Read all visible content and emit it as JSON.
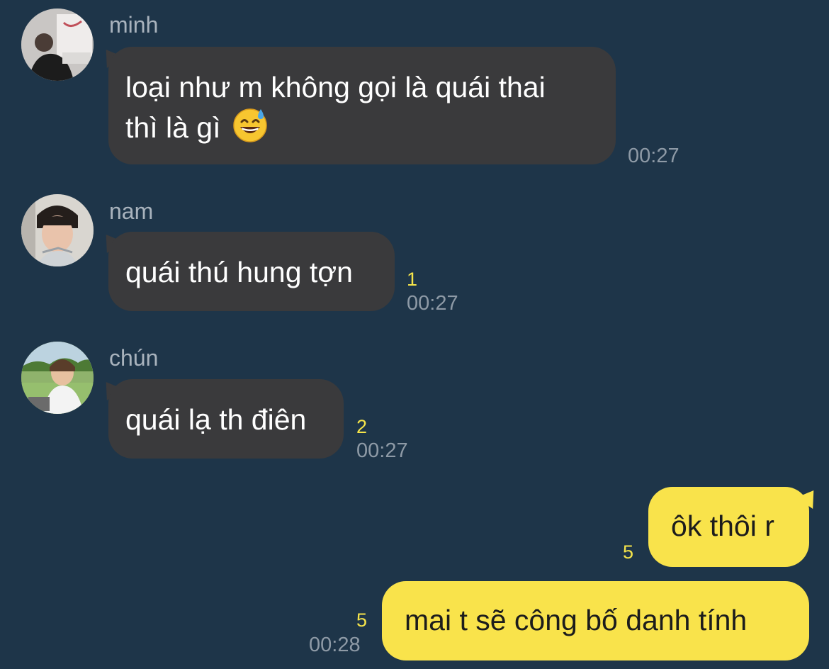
{
  "messages": [
    {
      "sender": "minh",
      "text_line1": "loại như m không gọi là quái thai",
      "text_line2": "thì là gì",
      "emoji": "grinning-sweat-emoji",
      "time": "00:27"
    },
    {
      "sender": "nam",
      "text": "quái thú hung tợn",
      "count": "1",
      "time": "00:27"
    },
    {
      "sender": "chún",
      "text": "quái lạ th điên",
      "count": "2",
      "time": "00:27"
    },
    {
      "text": "ôk thôi r",
      "count": "5"
    },
    {
      "text": "mai t sẽ công bố danh tính",
      "count": "5",
      "time": "00:28"
    }
  ],
  "colors": {
    "background": "#1e3549",
    "incoming_bubble": "#3a3a3c",
    "outgoing_bubble": "#f9e34b",
    "read_count": "#f5e44a",
    "timestamp": "#8e9aa6"
  }
}
